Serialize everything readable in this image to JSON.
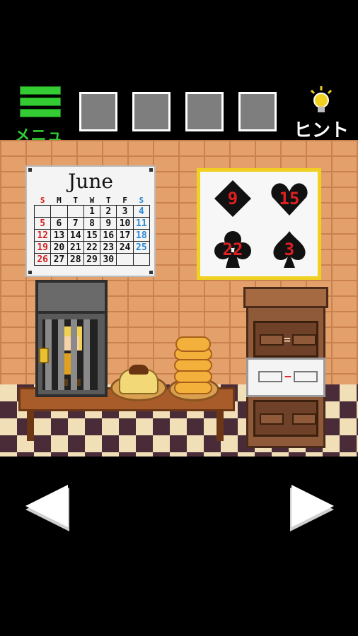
{
  "top_bar": {
    "menu_label": "メニュー",
    "hint_label": "ヒント",
    "inventory_slots": 4
  },
  "calendar": {
    "month": "June",
    "weekday_headers": [
      "S",
      "M",
      "T",
      "W",
      "T",
      "F",
      "S"
    ],
    "weeks": [
      [
        "",
        "",
        "",
        "1",
        "2",
        "3",
        "4"
      ],
      [
        "5",
        "6",
        "7",
        "8",
        "9",
        "10",
        "11"
      ],
      [
        "12",
        "13",
        "14",
        "15",
        "16",
        "17",
        "18"
      ],
      [
        "19",
        "20",
        "21",
        "22",
        "23",
        "24",
        "25"
      ],
      [
        "26",
        "27",
        "28",
        "29",
        "30",
        "",
        ""
      ]
    ]
  },
  "cards": {
    "diamond": "9",
    "heart": "15",
    "club": "22",
    "spade": "3"
  },
  "cabinet": {
    "drawer_top_symbol": "=",
    "drawer_middle_symbol": "−"
  },
  "colors": {
    "menu_green": "#33cc33",
    "number_red": "#e02020",
    "frame_yellow": "#f0d020"
  }
}
